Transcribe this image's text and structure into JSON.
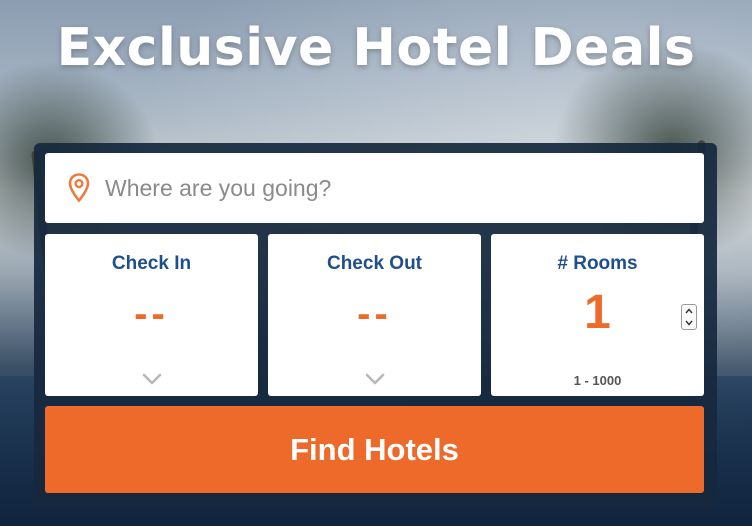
{
  "hero": {
    "headline": "Exclusive Hotel Deals"
  },
  "search": {
    "placeholder": "Where are you going?",
    "value": "",
    "icon": "map-pin-icon"
  },
  "check_in": {
    "label": "Check In",
    "value": "--",
    "icon": "chevron-down-icon"
  },
  "check_out": {
    "label": "Check Out",
    "value": "--",
    "icon": "chevron-down-icon"
  },
  "rooms": {
    "label": "# Rooms",
    "value": "1",
    "range": "1 - 1000"
  },
  "find_button": {
    "label": "Find Hotels"
  },
  "colors": {
    "accent": "#ee6a2b",
    "label_blue": "#1f4f8c",
    "panel": "#16283e"
  }
}
